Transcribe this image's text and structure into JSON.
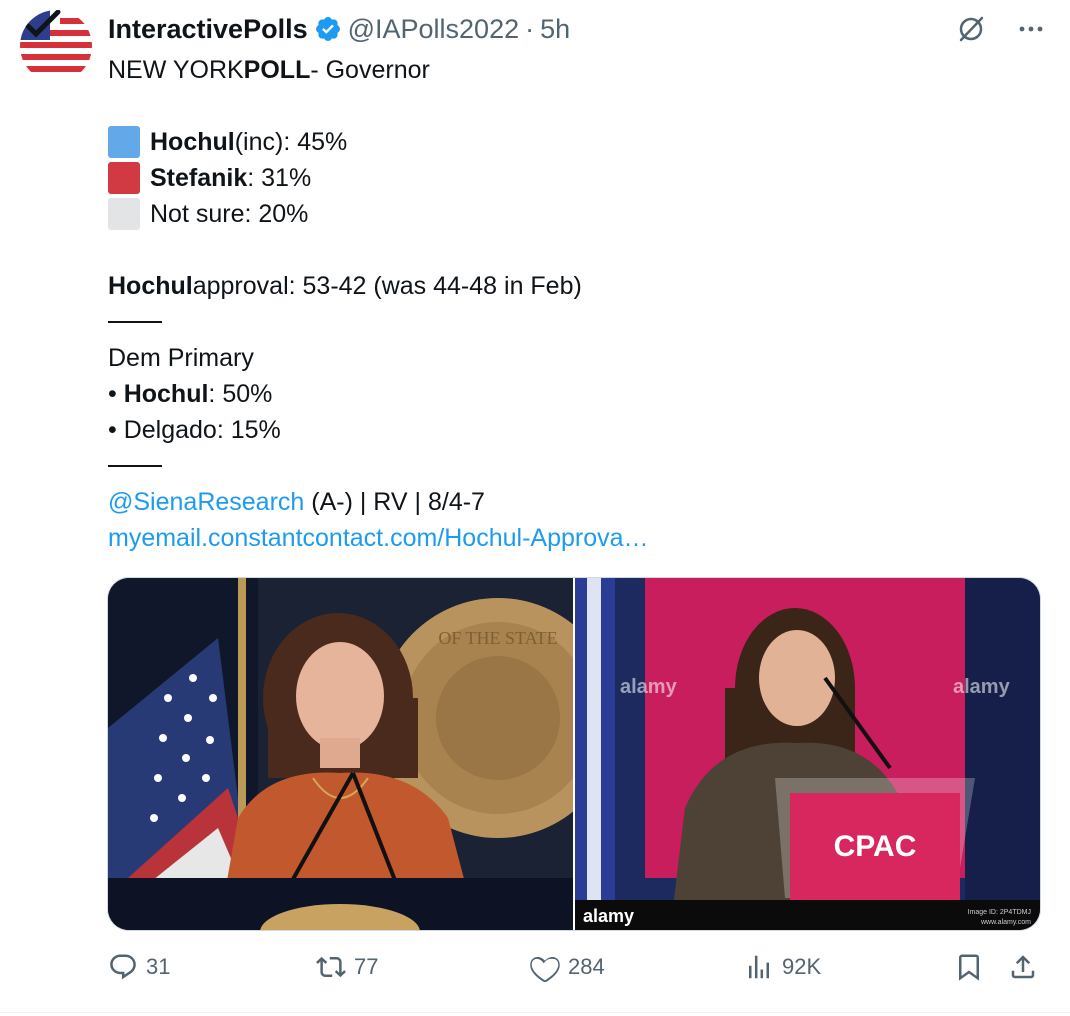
{
  "author": {
    "name": "InteractivePolls",
    "handle": "@IAPolls2022",
    "separator": "·",
    "time": "5h"
  },
  "icons": {
    "verified": "verified-badge-icon",
    "grok": "grok-icon",
    "more": "more-icon",
    "reply": "reply-icon",
    "repost": "repost-icon",
    "like": "like-icon",
    "views": "views-icon",
    "bookmark": "bookmark-icon",
    "share": "share-icon"
  },
  "colors": {
    "hochul": "#63a8e8",
    "stefanik": "#d13a43",
    "not_sure": "#e2e4e6",
    "link": "#1d9bf0"
  },
  "tweet": {
    "title_plain_1": "NEW YORK ",
    "title_bold": "POLL",
    "title_plain_2": " - Governor",
    "results": [
      {
        "name": "Hochul",
        "rest": " (inc): 45%"
      },
      {
        "name": "Stefanik",
        "rest": ": 31%"
      },
      {
        "name": "",
        "rest": "Not sure: 20%"
      }
    ],
    "approval_name": "Hochul",
    "approval_rest": " approval: 53-42 (was 44-48 in Feb)",
    "primary_title": "Dem Primary",
    "primary": [
      {
        "bullet": "• ",
        "name": "Hochul",
        "rest": ": 50%"
      },
      {
        "bullet": "• ",
        "name": "",
        "rest": "Delgado: 15%"
      }
    ],
    "source_mention": "@SienaResearch",
    "source_rest": " (A-) | RV | 8/4-7",
    "link": "myemail.constantcontact.com/Hochul-Approva…"
  },
  "media": {
    "left_seal_text": "OF THE STATE",
    "right_watermark": "alamy",
    "right_podium": "CPAC",
    "right_image_id": "Image ID: 2P4TDMJ",
    "right_url": "www.alamy.com"
  },
  "stats": {
    "replies": "31",
    "reposts": "77",
    "likes": "284",
    "views": "92K"
  }
}
